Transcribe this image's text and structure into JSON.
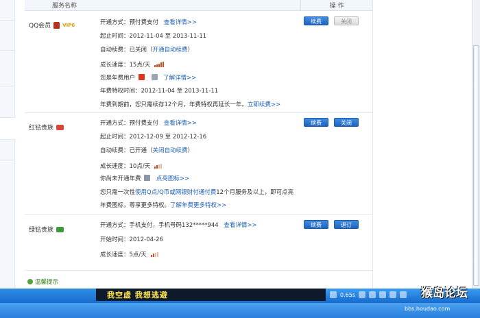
{
  "table": {
    "col_name": "服务名称",
    "col_op": "操 作"
  },
  "services": [
    {
      "name": "QQ会员",
      "badge": "VIP6",
      "pay_mode_label": "开通方式：",
      "pay_mode": "预付费支付",
      "detail_link": "查看详情>>",
      "start_label": "起止时间：",
      "start": "2012-11-04 至 2013-11-11",
      "auto_label": "自动续费：",
      "auto_state": "已关闭",
      "auto_link": "开通自动续费",
      "speed_label": "成长速度：",
      "speed": "15点/天",
      "speed_level": 5,
      "year_user": "您是年费用户",
      "year_link": "了解详情>>",
      "year_period_label": "年费特权时间：",
      "year_period": "2012-11-04 至 2013-11-11",
      "year_due": "年费到期前，您只需续存12个月，年费特权再延长一年。",
      "renew_link": "立即续费>>",
      "btn_primary": "续费",
      "btn_secondary": "关闭"
    },
    {
      "name": "红钻贵族",
      "pay_mode_label": "开通方式：",
      "pay_mode": "预付费支付",
      "detail_link": "查看详情>>",
      "start_label": "起止时间：",
      "start": "2012-12-09 至 2012-12-16",
      "auto_label": "自动续费：",
      "auto_state": "已开通",
      "auto_link": "关闭自动续费",
      "speed_label": "成长速度：",
      "speed": "10点/天",
      "speed_level": 2,
      "year_none": "你尚未开通年费",
      "light_link": "点亮图标>>",
      "offer_pre": "您只需一次性",
      "offer_link": "使用Q点/Q币或网银财付通付费",
      "offer_post": "12个月服务及以上，即可点亮",
      "offer_line2": "年费图标，尊享更多特权。",
      "more_link": "了解年费更多特权>>",
      "btn_primary": "续费",
      "btn_secondary": "关闭"
    },
    {
      "name": "绿钻贵族",
      "pay_mode_label": "开通方式：",
      "pay_mode": "手机支付，手机号码132*****944",
      "detail_link": "查看详情>>",
      "open_label": "开始时间：",
      "open_date": "2012-04-26",
      "speed_label": "成长速度：",
      "speed": "5点/天",
      "speed_level": 2,
      "btn_primary": "续费",
      "btn_secondary": "退订"
    }
  ],
  "tip": "温馨提示",
  "taskbar": {
    "subtitle": "我空虚 我想逃避",
    "tray_time": "0.65s"
  },
  "watermark": {
    "brand": "猴岛论坛",
    "url": "bbs.houdao.com"
  },
  "colors": {
    "link": "#1a5fb4",
    "button": "#1e63c0",
    "taskbar": "#1a6fd0"
  }
}
